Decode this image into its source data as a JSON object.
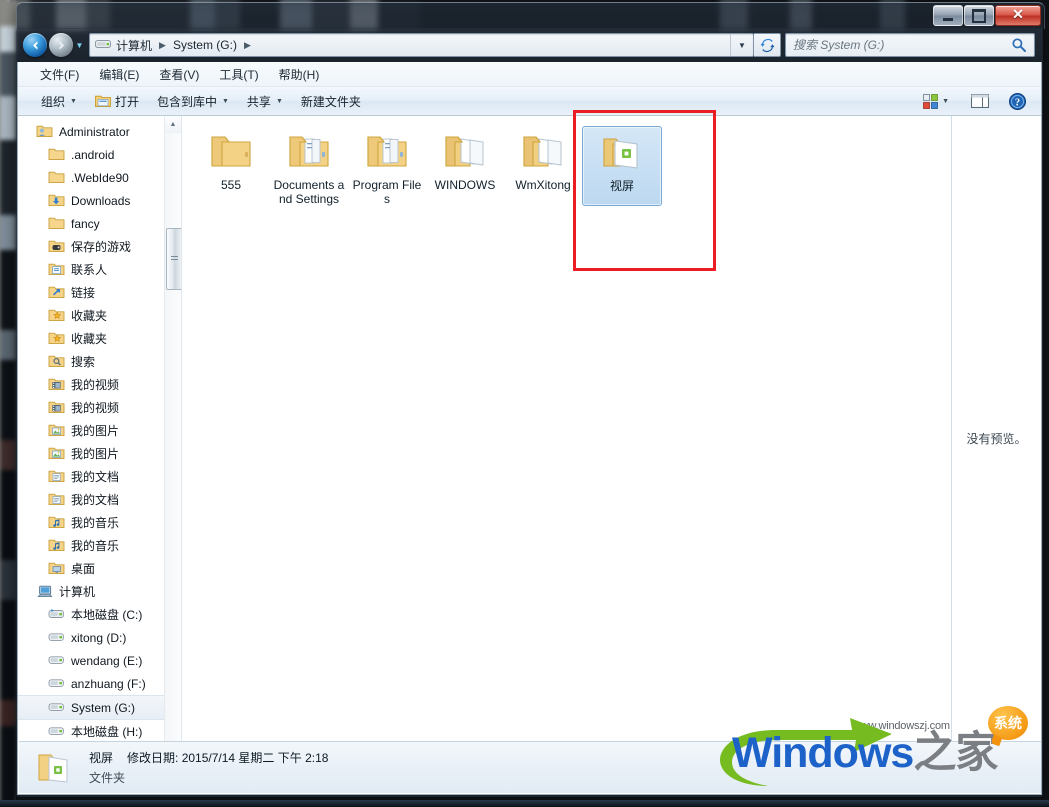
{
  "window": {
    "controls": {
      "minimize": "–",
      "maximize": "□",
      "close": "✕"
    }
  },
  "address": {
    "crumbs": [
      "计算机",
      "System (G:)"
    ],
    "separator": "▶",
    "dropdown_icon": "▼",
    "refresh_icon": "refresh-icon",
    "back_icon": "back-arrow-icon",
    "forward_icon": "forward-arrow-icon",
    "history_icon": "▼"
  },
  "search": {
    "placeholder": "搜索 System (G:)",
    "value": "",
    "icon": "search-icon"
  },
  "menubar": {
    "items": [
      "文件(F)",
      "编辑(E)",
      "查看(V)",
      "工具(T)",
      "帮助(H)"
    ]
  },
  "toolbar": {
    "organize": "组织",
    "open": "打开",
    "include_library": "包含到库中",
    "share": "共享",
    "new_folder": "新建文件夹",
    "chevron": "▼",
    "view_icon": "view-options-icon",
    "preview_icon": "preview-pane-icon",
    "help_icon": "help-icon"
  },
  "sidebar": {
    "items": [
      {
        "label": "Administrator",
        "icon": "user-folder-icon",
        "indent": 0,
        "selected": false
      },
      {
        "label": ".android",
        "icon": "folder-icon",
        "indent": 1,
        "selected": false
      },
      {
        "label": ".WebIde90",
        "icon": "folder-icon",
        "indent": 1,
        "selected": false
      },
      {
        "label": "Downloads",
        "icon": "downloads-folder-icon",
        "indent": 1,
        "selected": false
      },
      {
        "label": "fancy",
        "icon": "folder-icon",
        "indent": 1,
        "selected": false
      },
      {
        "label": "保存的游戏",
        "icon": "saved-games-folder-icon",
        "indent": 1,
        "selected": false
      },
      {
        "label": "联系人",
        "icon": "contacts-folder-icon",
        "indent": 1,
        "selected": false
      },
      {
        "label": "链接",
        "icon": "links-folder-icon",
        "indent": 1,
        "selected": false
      },
      {
        "label": "收藏夹",
        "icon": "favorites-folder-icon",
        "indent": 1,
        "selected": false
      },
      {
        "label": "收藏夹",
        "icon": "favorites-folder-icon",
        "indent": 1,
        "selected": false
      },
      {
        "label": "搜索",
        "icon": "search-folder-icon",
        "indent": 1,
        "selected": false
      },
      {
        "label": "我的视频",
        "icon": "videos-folder-icon",
        "indent": 1,
        "selected": false
      },
      {
        "label": "我的视频",
        "icon": "videos-folder-icon",
        "indent": 1,
        "selected": false
      },
      {
        "label": "我的图片",
        "icon": "pictures-folder-icon",
        "indent": 1,
        "selected": false
      },
      {
        "label": "我的图片",
        "icon": "pictures-folder-icon",
        "indent": 1,
        "selected": false
      },
      {
        "label": "我的文档",
        "icon": "documents-folder-icon",
        "indent": 1,
        "selected": false
      },
      {
        "label": "我的文档",
        "icon": "documents-folder-icon",
        "indent": 1,
        "selected": false
      },
      {
        "label": "我的音乐",
        "icon": "music-folder-icon",
        "indent": 1,
        "selected": false
      },
      {
        "label": "我的音乐",
        "icon": "music-folder-icon",
        "indent": 1,
        "selected": false
      },
      {
        "label": "桌面",
        "icon": "desktop-folder-icon",
        "indent": 1,
        "selected": false
      },
      {
        "label": "计算机",
        "icon": "computer-icon",
        "indent": 0,
        "selected": false
      },
      {
        "label": "本地磁盘 (C:)",
        "icon": "system-drive-icon",
        "indent": 1,
        "selected": false
      },
      {
        "label": "xitong (D:)",
        "icon": "drive-icon",
        "indent": 1,
        "selected": false
      },
      {
        "label": "wendang (E:)",
        "icon": "drive-icon",
        "indent": 1,
        "selected": false
      },
      {
        "label": "anzhuang (F:)",
        "icon": "drive-icon",
        "indent": 1,
        "selected": false
      },
      {
        "label": "System (G:)",
        "icon": "drive-icon",
        "indent": 1,
        "selected": true
      },
      {
        "label": "本地磁盘 (H:)",
        "icon": "drive-icon",
        "indent": 1,
        "selected": false
      }
    ],
    "scrollbar": {
      "up_arrow": "▲",
      "down_arrow": "▼"
    }
  },
  "files": {
    "items": [
      {
        "name": "555",
        "icon": "folder-icon",
        "selected": false
      },
      {
        "name": "Documents and Settings",
        "icon": "folder-docs-icon",
        "selected": false
      },
      {
        "name": "Program Files",
        "icon": "folder-docs-icon",
        "selected": false
      },
      {
        "name": "WINDOWS",
        "icon": "folder-pages-icon",
        "selected": false
      },
      {
        "name": "WmXitong",
        "icon": "folder-pages-icon",
        "selected": false
      },
      {
        "name": "视屏",
        "icon": "open-folder-green-icon",
        "selected": true
      }
    ]
  },
  "preview": {
    "no_preview_text": "没有预览。"
  },
  "details": {
    "name": "视屏",
    "modified_label": "修改日期:",
    "modified_value": "2015/7/14 星期二 下午 2:18",
    "type": "文件夹",
    "icon": "open-folder-green-icon"
  },
  "watermark": {
    "url": "www.windowszj.com",
    "brand_latin": "Windows",
    "brand_cn": "之家",
    "badge": "系统"
  },
  "colors": {
    "accent_blue": "#1d62c9",
    "annotation_red": "#ec1c24",
    "selection_blue": "#bcd8f0",
    "folder_yellow": "#f5d78a",
    "badge_orange": "#f59a15"
  }
}
